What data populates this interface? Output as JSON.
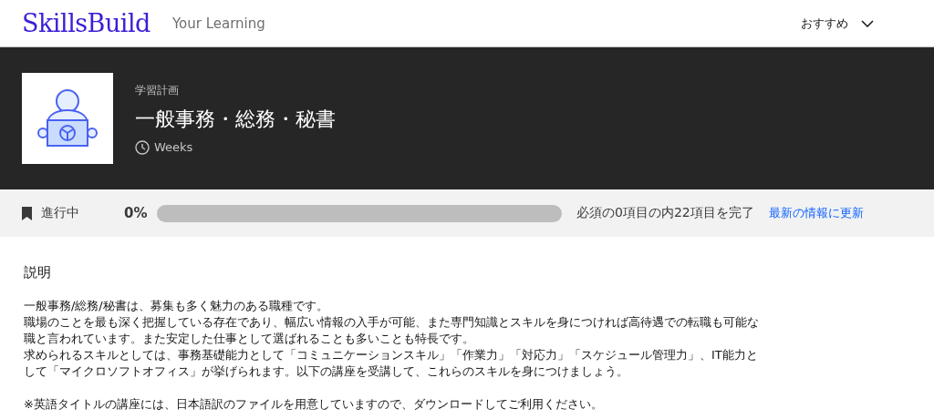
{
  "header": {
    "logo": "SkillsBuild",
    "subtitle": "Your Learning",
    "menu": "おすすめ"
  },
  "hero": {
    "eyebrow": "学習計画",
    "title": "一般事務・総務・秘書",
    "duration": "Weeks"
  },
  "progress": {
    "status": "進行中",
    "percent": "0%",
    "level": 0,
    "summary": "必須の0項目の内22項目を完了",
    "refresh_link": "最新の情報に更新"
  },
  "description": {
    "heading": "説明",
    "paragraphs": [
      "一般事務/総務/秘書は、募集も多く魅力のある職種です。",
      "職場のことを最も深く把握している存在であり、幅広い情報の入手が可能、また専門知識とスキルを身につければ高待遇での転職も可能な職と言われています。また安定した仕事として選ばれることも多いことも特長です。",
      "求められるスキルとしては、事務基礎能力として「コミュニケーションスキル」「作業力」「対応力」「スケジュール管理力」、IT能力として「マイクロソフトオフィス」が挙げられます。以下の講座を受講して、これらのスキルを身につけましょう。"
    ],
    "note": "※英語タイトルの講座には、日本語訳のファイルを用意していますので、ダウンロードしてご利用ください。"
  }
}
